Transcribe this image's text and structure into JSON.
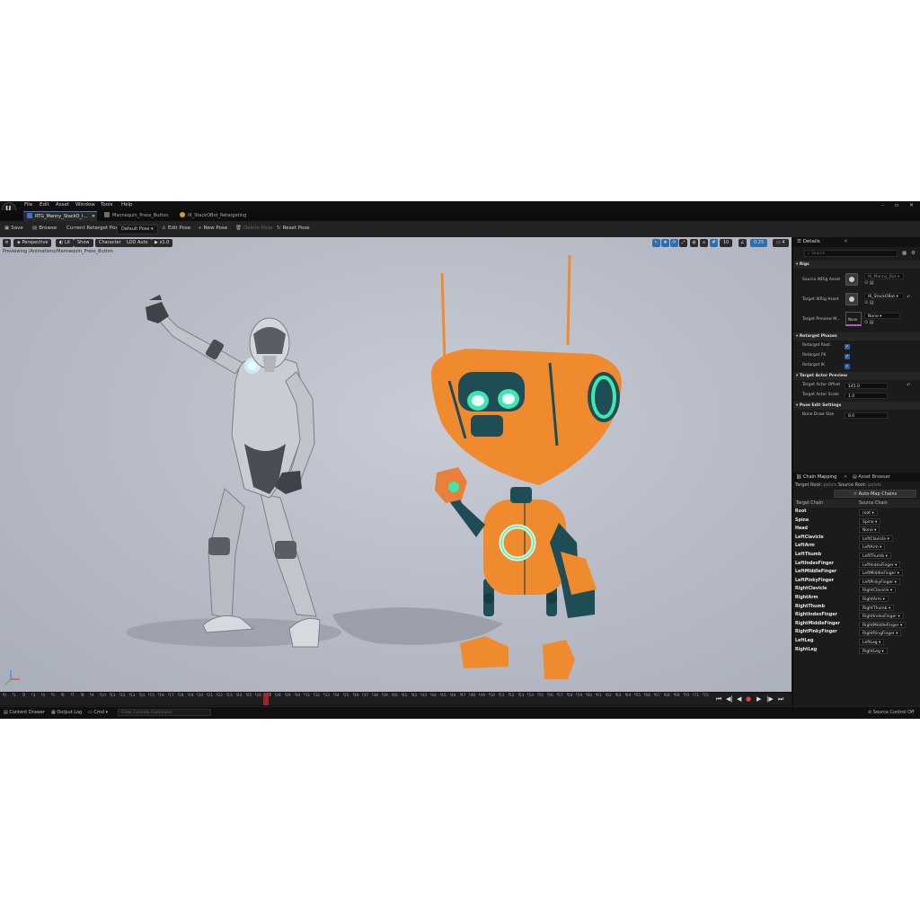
{
  "menu": [
    "File",
    "Edit",
    "Asset",
    "Window",
    "Tools",
    "Help"
  ],
  "tabs": [
    {
      "label": "RTG_Manny_StackO_I...",
      "color": "#3b6fd1"
    },
    {
      "label": "Mannequin_Press_Button",
      "color": "#7a6f5a"
    },
    {
      "label": "IK_StackOBot_Retargeting",
      "color": "#c9a227"
    }
  ],
  "toolbar": {
    "save": "Save",
    "browse": "Browse",
    "current_pose_label": "Current Retarget Pose:",
    "current_pose_value": "Default Pose",
    "edit_pose": "Edit Pose",
    "new_pose": "New Pose",
    "delete_pose": "Delete Pose",
    "reset_pose": "Reset Pose"
  },
  "viewport": {
    "perspective": "Perspective",
    "lit": "Lit",
    "show": "Show",
    "character": "Character",
    "lod": "LOD Auto",
    "speed": "x1.0",
    "path": "Previewing /Animations/Mannequin_Press_Button",
    "snap": "10",
    "fov": "0.25",
    "cam": "4"
  },
  "timeline": {
    "frames": [
      "0",
      "1",
      "2",
      "3",
      "4",
      "5",
      "6",
      "7",
      "8",
      "9",
      "10",
      "11",
      "12",
      "13",
      "14",
      "15",
      "16",
      "17",
      "18",
      "19",
      "20",
      "21",
      "22",
      "23",
      "24",
      "25",
      "26",
      "27",
      "28",
      "29",
      "30",
      "31",
      "32",
      "33",
      "34",
      "35",
      "36",
      "37",
      "38",
      "39",
      "40",
      "41",
      "42",
      "43",
      "44",
      "45",
      "46",
      "47",
      "48",
      "49",
      "50",
      "51",
      "52",
      "53",
      "54",
      "55",
      "56",
      "57",
      "58",
      "59",
      "60",
      "61",
      "62",
      "63",
      "64",
      "65",
      "66",
      "67",
      "68",
      "69",
      "70",
      "71",
      "72"
    ],
    "current": "27",
    "current_progress": 0.375
  },
  "status": {
    "content_drawer": "Content Drawer",
    "output_log": "Output Log",
    "cmd": "Cmd",
    "cmd_placeholder": "Enter Console Command",
    "source_control": "Source Control Off"
  },
  "details": {
    "tab": "Details",
    "search_placeholder": "Search",
    "sections": {
      "rigs": "Rigs",
      "retarget_phases": "Retarget Phases",
      "target_actor_preview": "Target Actor Preview",
      "pose_edit": "Pose Edit Settings"
    },
    "source_ik_label": "Source IKRig Asset",
    "source_ik_value": "IK_Manny_Bot",
    "target_ik_label": "Target IKRig Asset",
    "target_ik_value": "IK_StackOBot",
    "target_preview_label": "Target Preview M...",
    "target_preview_value": "None",
    "target_preview_thumb": "None",
    "retarget_root": "Retarget Root",
    "retarget_fk": "Retarget FK",
    "retarget_ik": "Retarget IK",
    "offset_label": "Target Actor Offset",
    "offset_value": "145.0",
    "scale_label": "Target Actor Scale",
    "scale_value": "1.0",
    "bone_size_label": "Bone Draw Size",
    "bone_size_value": "8.0"
  },
  "chain_panel": {
    "tab_chain": "Chain Mapping",
    "tab_asset": "Asset Browser",
    "target_root_label": "Target Root:",
    "target_root_value": "pelvis",
    "source_root_label": "Source Root:",
    "source_root_value": "pelvis",
    "automap": "Auto-Map Chains",
    "col_target": "Target Chain",
    "col_source": "Source Chain",
    "rows": [
      {
        "target": "Root",
        "source": "root"
      },
      {
        "target": "Spine",
        "source": "Spine"
      },
      {
        "target": "Head",
        "source": "None"
      },
      {
        "target": "LeftClavicle",
        "source": "LeftClavicle"
      },
      {
        "target": "LeftArm",
        "source": "LeftArm"
      },
      {
        "target": "LeftThumb",
        "source": "LeftThumb"
      },
      {
        "target": "LeftIndexFinger",
        "source": "LeftIndexFinger"
      },
      {
        "target": "LeftMiddleFinger",
        "source": "LeftMiddleFinger"
      },
      {
        "target": "LeftPinkyFinger",
        "source": "LeftPinkyFinger"
      },
      {
        "target": "RightClavicle",
        "source": "RightClavicle"
      },
      {
        "target": "RightArm",
        "source": "RightArm"
      },
      {
        "target": "RightThumb",
        "source": "RightThumb"
      },
      {
        "target": "RightIndexFinger",
        "source": "RightIndexFinger"
      },
      {
        "target": "RightMiddleFinger",
        "source": "RightMiddleFinger"
      },
      {
        "target": "RightPinkyFinger",
        "source": "RightRingFinger"
      },
      {
        "target": "LeftLeg",
        "source": "LeftLeg"
      },
      {
        "target": "RightLeg",
        "source": "RightLeg"
      }
    ]
  },
  "colors": {
    "accent": "#2e6db0",
    "robot_orange": "#f08a2e",
    "robot_teal": "#1f4d55",
    "glow": "#3fe6b0"
  }
}
